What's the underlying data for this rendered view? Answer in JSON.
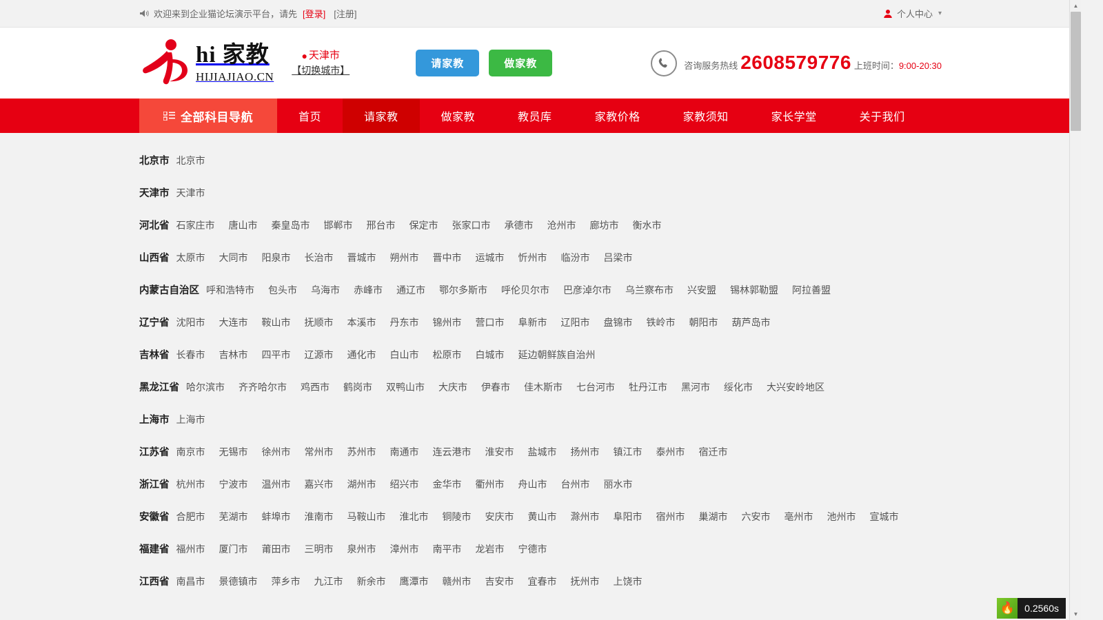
{
  "topbar": {
    "speaker_icon": "speaker-icon",
    "welcome": "欢迎来到企业猫论坛演示平台，请先",
    "login": "[登录]",
    "register": "[注册]",
    "user_icon": "user-icon",
    "user_center": "个人中心",
    "caret_icon": "chevron-down-icon"
  },
  "header": {
    "logo_title": "hi 家教",
    "logo_sub": "HIJIAJIAO.CN",
    "pin_icon": "location-pin-icon",
    "city_name": "天津市",
    "city_switch": "【切换城市】",
    "btn_request": "请家教",
    "btn_become": "做家教",
    "phone_icon": "phone-icon",
    "hotline_label": "咨询服务热线",
    "hotline_number": "2608579776",
    "hotline_hours_label": "上班时间：",
    "hotline_hours_value": "9:00-20:30"
  },
  "nav": {
    "all_subjects_icon": "grid-menu-icon",
    "all_subjects": "全部科目导航",
    "items": [
      {
        "label": "首页",
        "active": false
      },
      {
        "label": "请家教",
        "active": true
      },
      {
        "label": "做家教",
        "active": false
      },
      {
        "label": "教员库",
        "active": false
      },
      {
        "label": "家教价格",
        "active": false
      },
      {
        "label": "家教须知",
        "active": false
      },
      {
        "label": "家长学堂",
        "active": false
      },
      {
        "label": "关于我们",
        "active": false
      }
    ]
  },
  "city_list": [
    {
      "province": "北京市",
      "cities": [
        "北京市"
      ]
    },
    {
      "province": "天津市",
      "cities": [
        "天津市"
      ]
    },
    {
      "province": "河北省",
      "cities": [
        "石家庄市",
        "唐山市",
        "秦皇岛市",
        "邯郸市",
        "邢台市",
        "保定市",
        "张家口市",
        "承德市",
        "沧州市",
        "廊坊市",
        "衡水市"
      ]
    },
    {
      "province": "山西省",
      "cities": [
        "太原市",
        "大同市",
        "阳泉市",
        "长治市",
        "晋城市",
        "朔州市",
        "晋中市",
        "运城市",
        "忻州市",
        "临汾市",
        "吕梁市"
      ]
    },
    {
      "province": "内蒙古自治区",
      "cities": [
        "呼和浩特市",
        "包头市",
        "乌海市",
        "赤峰市",
        "通辽市",
        "鄂尔多斯市",
        "呼伦贝尔市",
        "巴彦淖尔市",
        "乌兰察布市",
        "兴安盟",
        "锡林郭勒盟",
        "阿拉善盟"
      ]
    },
    {
      "province": "辽宁省",
      "cities": [
        "沈阳市",
        "大连市",
        "鞍山市",
        "抚顺市",
        "本溪市",
        "丹东市",
        "锦州市",
        "营口市",
        "阜新市",
        "辽阳市",
        "盘锦市",
        "铁岭市",
        "朝阳市",
        "葫芦岛市"
      ]
    },
    {
      "province": "吉林省",
      "cities": [
        "长春市",
        "吉林市",
        "四平市",
        "辽源市",
        "通化市",
        "白山市",
        "松原市",
        "白城市",
        "延边朝鲜族自治州"
      ]
    },
    {
      "province": "黑龙江省",
      "cities": [
        "哈尔滨市",
        "齐齐哈尔市",
        "鸡西市",
        "鹤岗市",
        "双鸭山市",
        "大庆市",
        "伊春市",
        "佳木斯市",
        "七台河市",
        "牡丹江市",
        "黑河市",
        "绥化市",
        "大兴安岭地区"
      ]
    },
    {
      "province": "上海市",
      "cities": [
        "上海市"
      ]
    },
    {
      "province": "江苏省",
      "cities": [
        "南京市",
        "无锡市",
        "徐州市",
        "常州市",
        "苏州市",
        "南通市",
        "连云港市",
        "淮安市",
        "盐城市",
        "扬州市",
        "镇江市",
        "泰州市",
        "宿迁市"
      ]
    },
    {
      "province": "浙江省",
      "cities": [
        "杭州市",
        "宁波市",
        "温州市",
        "嘉兴市",
        "湖州市",
        "绍兴市",
        "金华市",
        "衢州市",
        "舟山市",
        "台州市",
        "丽水市"
      ]
    },
    {
      "province": "安徽省",
      "cities": [
        "合肥市",
        "芜湖市",
        "蚌埠市",
        "淮南市",
        "马鞍山市",
        "淮北市",
        "铜陵市",
        "安庆市",
        "黄山市",
        "滁州市",
        "阜阳市",
        "宿州市",
        "巢湖市",
        "六安市",
        "亳州市",
        "池州市",
        "宣城市"
      ]
    },
    {
      "province": "福建省",
      "cities": [
        "福州市",
        "厦门市",
        "莆田市",
        "三明市",
        "泉州市",
        "漳州市",
        "南平市",
        "龙岩市",
        "宁德市"
      ]
    },
    {
      "province": "江西省",
      "cities": [
        "南昌市",
        "景德镇市",
        "萍乡市",
        "九江市",
        "新余市",
        "鹰潭市",
        "赣州市",
        "吉安市",
        "宜春市",
        "抚州市",
        "上饶市"
      ]
    }
  ],
  "scrollbar": {
    "up_icon": "scroll-up-arrow-icon",
    "down_icon": "scroll-down-arrow-icon"
  },
  "debug_badge": {
    "logo_icon": "thinkphp-flame-icon",
    "time": "0.2560s",
    "caret_icon": "chevron-down-icon"
  },
  "colors": {
    "brand_red": "#e60012",
    "nav_red": "#e60012",
    "nav_all_red": "#f5483a",
    "nav_active_red": "#cf0000",
    "btn_blue": "#3498db",
    "btn_green": "#3cb944",
    "page_bg": "#f2f2f2"
  }
}
